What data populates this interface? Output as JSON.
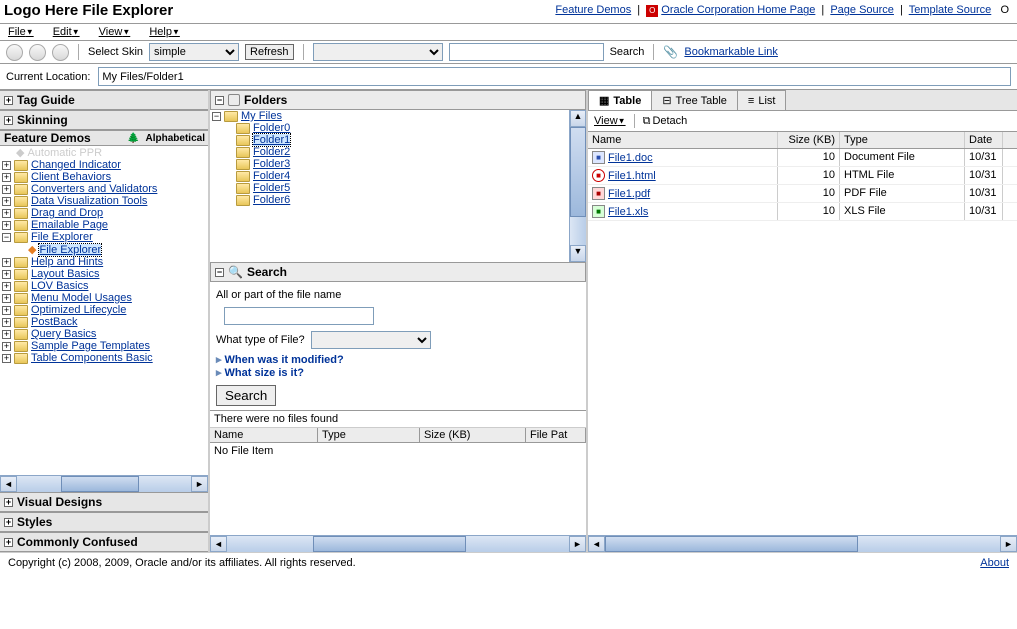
{
  "header": {
    "logo": "Logo Here",
    "title": "File Explorer",
    "links": {
      "feature_demos": "Feature Demos",
      "oracle_home": "Oracle Corporation Home Page",
      "page_source": "Page Source",
      "template_source": "Template Source",
      "mode_indicator": "O"
    }
  },
  "menubar": {
    "file": "File",
    "edit": "Edit",
    "view": "View",
    "help": "Help"
  },
  "toolbar": {
    "select_skin_label": "Select Skin",
    "skin_value": "simple",
    "refresh": "Refresh",
    "search": "Search",
    "bookmarkable": "Bookmarkable Link"
  },
  "location": {
    "label": "Current Location:",
    "value": "My Files/Folder1"
  },
  "left_acc": {
    "tag_guide": "Tag Guide",
    "skinning": "Skinning",
    "feature_demos": "Feature Demos",
    "az_tab": "Alphabetical",
    "visual_designs": "Visual Designs",
    "styles": "Styles",
    "commonly_confused": "Commonly Confused",
    "items": [
      "Automatic PPR",
      "Changed Indicator",
      "Client Behaviors",
      "Converters and Validators",
      "Data Visualization Tools",
      "Drag and Drop",
      "Emailable Page",
      "File Explorer",
      "Help and Hints",
      "Layout Basics",
      "LOV Basics",
      "Menu Model Usages",
      "Optimized Lifecycle",
      "PostBack",
      "Query Basics",
      "Sample Page Templates",
      "Table Components Basic"
    ],
    "child": "File Explorer"
  },
  "folders_panel": {
    "title": "Folders",
    "root": "My Files",
    "items": [
      "Folder0",
      "Folder1",
      "Folder2",
      "Folder3",
      "Folder4",
      "Folder5",
      "Folder6"
    ],
    "selected": "Folder1"
  },
  "search_panel": {
    "title": "Search",
    "name_label": "All or part of the file name",
    "type_label": "What type of File?",
    "modified": "When was it modified?",
    "size": "What size is it?",
    "button": "Search",
    "no_files": "There were no files found",
    "cols": {
      "name": "Name",
      "type": "Type",
      "size": "Size (KB)",
      "path": "File Pat"
    },
    "empty": "No File Item"
  },
  "right_panel": {
    "tabs": {
      "table": "Table",
      "tree_table": "Tree Table",
      "list": "List"
    },
    "view_menu": "View",
    "detach": "Detach",
    "cols": {
      "name": "Name",
      "size": "Size (KB)",
      "type": "Type",
      "date": "Date"
    },
    "rows": [
      {
        "name": "File1.doc",
        "size": "10",
        "type": "Document File",
        "date": "10/31",
        "ic": "doc"
      },
      {
        "name": "File1.html",
        "size": "10",
        "type": "HTML File",
        "date": "10/31",
        "ic": "html"
      },
      {
        "name": "File1.pdf",
        "size": "10",
        "type": "PDF File",
        "date": "10/31",
        "ic": "pdf"
      },
      {
        "name": "File1.xls",
        "size": "10",
        "type": "XLS File",
        "date": "10/31",
        "ic": "xls"
      }
    ]
  },
  "footer": {
    "copy": "Copyright (c) 2008, 2009, Oracle and/or its affiliates. All rights reserved.",
    "about": "About"
  }
}
